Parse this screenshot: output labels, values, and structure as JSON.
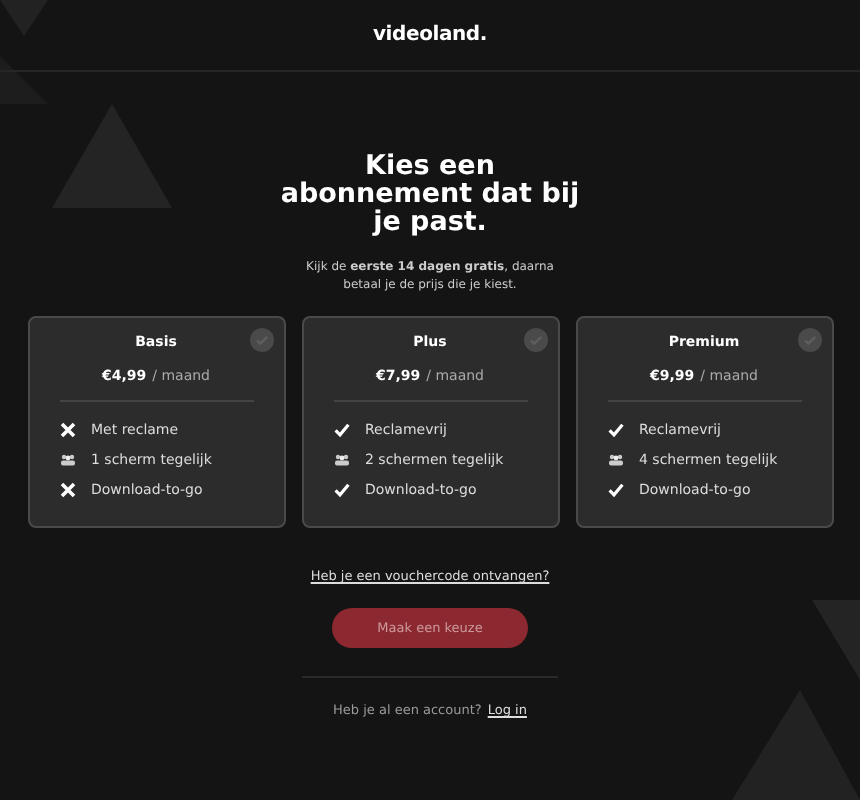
{
  "logo": "videoland.",
  "title": "Kies een abonnement dat bij je past.",
  "subtitle": "Kijk de **eerste 14 dagen gratis**, daarna betaal je de prijs die je kiest.",
  "plans": [
    {
      "name": "Basis",
      "price": "€4,99",
      "period": "/ maand",
      "selected": false,
      "features": [
        {
          "kind": "cross",
          "text": "Met reclame"
        },
        {
          "kind": "screens",
          "text": "1 scherm tegelijk"
        },
        {
          "kind": "cross",
          "text": "Download-to-go"
        }
      ]
    },
    {
      "name": "Plus",
      "price": "€7,99",
      "period": "/ maand",
      "selected": false,
      "features": [
        {
          "kind": "check",
          "text": "Reclamevrij"
        },
        {
          "kind": "screens",
          "text": "2 schermen tegelijk"
        },
        {
          "kind": "check",
          "text": "Download-to-go"
        }
      ]
    },
    {
      "name": "Premium",
      "price": "€9,99",
      "period": "/ maand",
      "selected": false,
      "features": [
        {
          "kind": "check",
          "text": "Reclamevrij"
        },
        {
          "kind": "screens",
          "text": "4 schermen tegelijk"
        },
        {
          "kind": "check",
          "text": "Download-to-go"
        }
      ]
    }
  ],
  "voucher_link": "Heb je een vouchercode ontvangen?",
  "continue_button": {
    "label": "Maak een keuze",
    "disabled": true
  },
  "login_prompt": "Heb je al een account?",
  "login_link": "Log in"
}
